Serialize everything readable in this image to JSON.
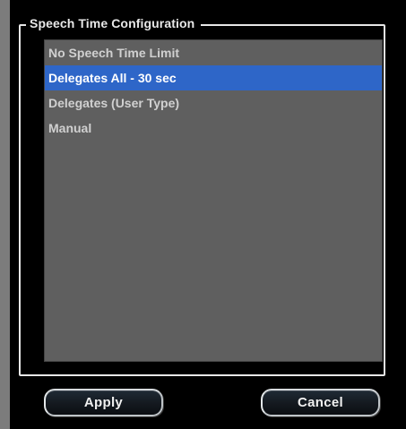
{
  "dialog": {
    "group_title": "Speech Time Configuration",
    "options": [
      {
        "label": "No Speech Time Limit",
        "selected": false
      },
      {
        "label": "Delegates All - 30 sec",
        "selected": true
      },
      {
        "label": "Delegates (User Type)",
        "selected": false
      },
      {
        "label": "Manual",
        "selected": false
      }
    ],
    "apply_label": "Apply",
    "cancel_label": "Cancel"
  },
  "colors": {
    "selection": "#2e66c8",
    "list_background": "#5f5f5f",
    "frame": "#e8e8e8"
  }
}
